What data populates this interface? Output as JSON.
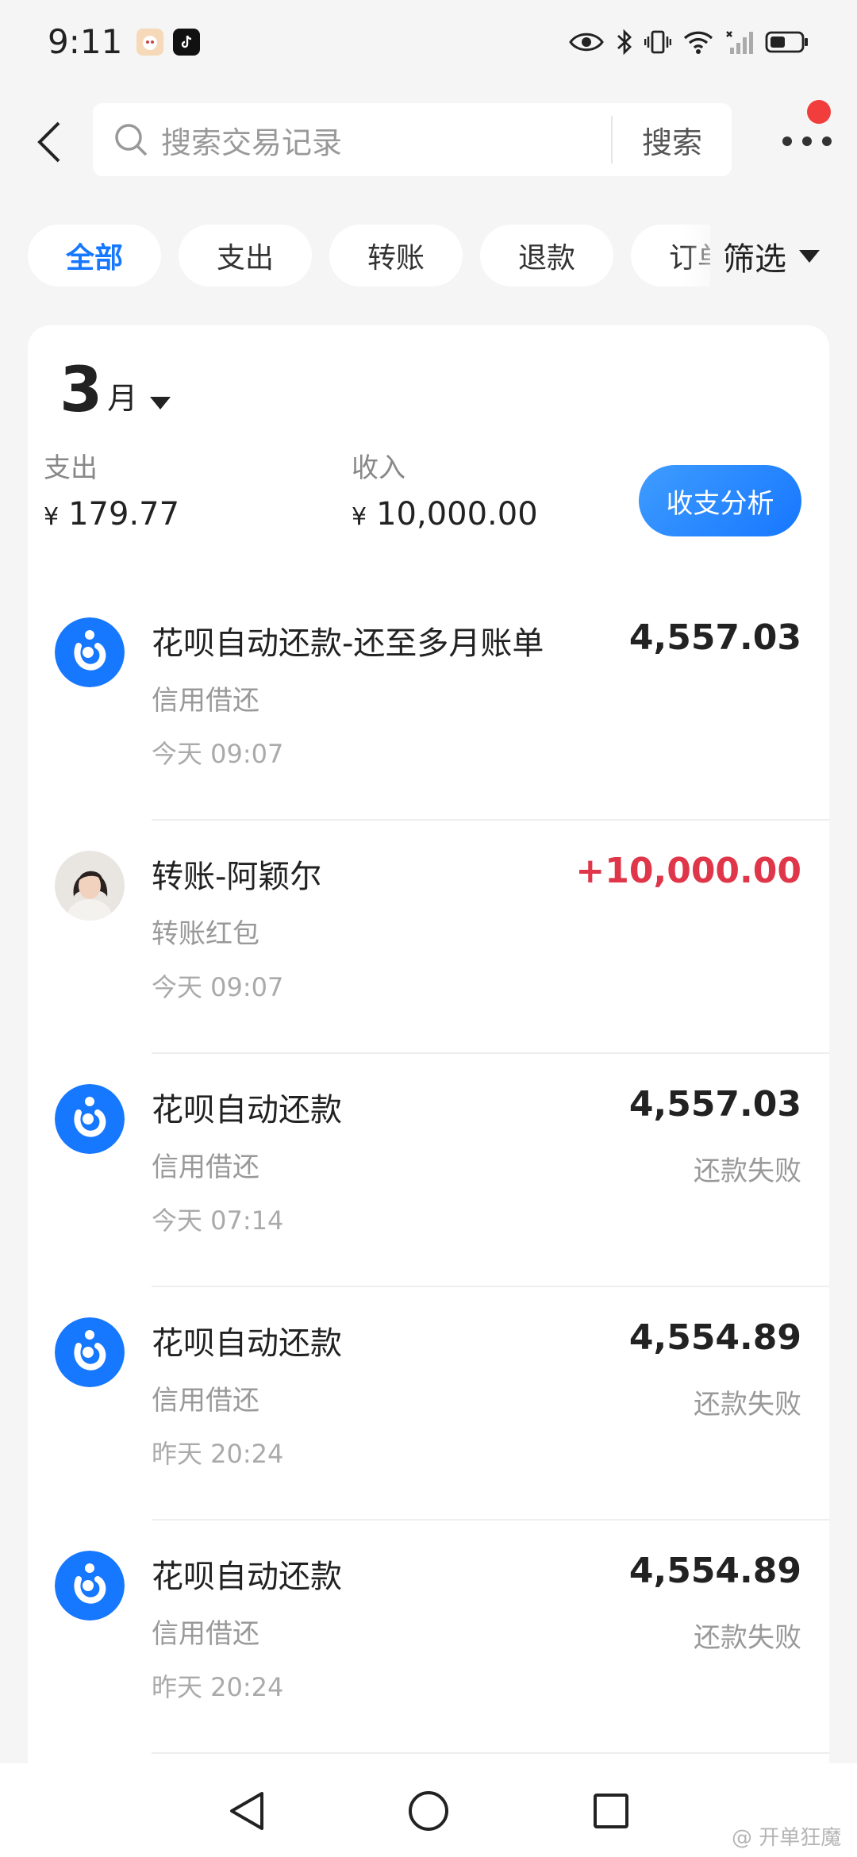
{
  "status_bar": {
    "time": "9:11",
    "icons": [
      "app-icon-1",
      "tiktok-icon",
      "eye-icon",
      "bluetooth-icon",
      "vibrate-icon",
      "wifi-icon",
      "signal-icon",
      "battery-icon"
    ]
  },
  "header": {
    "search_placeholder": "搜索交易记录",
    "search_button": "搜索"
  },
  "filters": {
    "chips": [
      "全部",
      "支出",
      "转账",
      "退款",
      "订单"
    ],
    "active_index": 0,
    "filter_label": "筛选"
  },
  "summary": {
    "month_number": "3",
    "month_unit": "月",
    "expense_label": "支出",
    "expense_value": "179.77",
    "income_label": "收入",
    "income_value": "10,000.00",
    "currency": "¥",
    "analysis_button": "收支分析"
  },
  "transactions": [
    {
      "title": "花呗自动还款-还至多月账单",
      "subtitle": "信用借还",
      "time": "今天 09:07",
      "amount": "4,557.03",
      "status": "",
      "type": "huabei"
    },
    {
      "title": "转账-阿颖尔",
      "subtitle": "转账红包",
      "time": "今天 09:07",
      "amount": "+10,000.00",
      "status": "",
      "type": "person"
    },
    {
      "title": "花呗自动还款",
      "subtitle": "信用借还",
      "time": "今天 07:14",
      "amount": "4,557.03",
      "status": "还款失败",
      "type": "huabei"
    },
    {
      "title": "花呗自动还款",
      "subtitle": "信用借还",
      "time": "昨天 20:24",
      "amount": "4,554.89",
      "status": "还款失败",
      "type": "huabei"
    },
    {
      "title": "花呗自动还款",
      "subtitle": "信用借还",
      "time": "昨天 20:24",
      "amount": "4,554.89",
      "status": "还款失败",
      "type": "huabei"
    }
  ],
  "colors": {
    "accent": "#1677ff",
    "income": "#e0364a",
    "notification": "#f23d3d"
  },
  "watermark": "@ 开单狂魔"
}
